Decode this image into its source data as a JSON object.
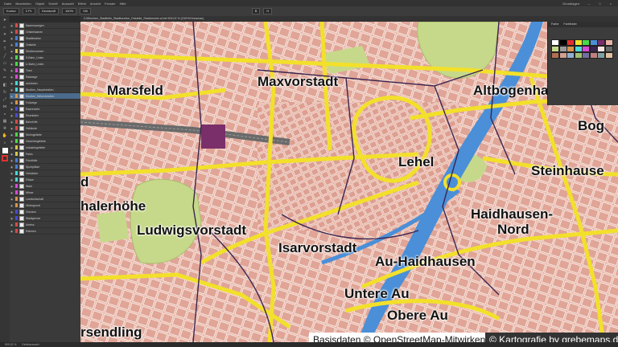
{
  "menubar": {
    "items": [
      "Datei",
      "Bearbeiten",
      "Objekt",
      "Schrift",
      "Auswahl",
      "Effekt",
      "Ansicht",
      "Fenster",
      "Hilfe"
    ],
    "workspace": "Grundlagen"
  },
  "controlbar": {
    "fields": [
      "Kontur",
      "2 Pt.",
      "Deckkraft",
      "100%",
      "Stil",
      "B",
      "H"
    ]
  },
  "document_tab": "2-München_Stadtteile_Stadtbezirke_Ortsteile_Straßennetz.ai bei 509,02 % (CMYK/Vorschau)",
  "layers": [
    {
      "name": "Namenszeigen",
      "color": "#d84a4a"
    },
    {
      "name": "Ortsteilnamen",
      "color": "#d84a4a"
    },
    {
      "name": "Stadtbezirke",
      "color": "#4a7fd8"
    },
    {
      "name": "Ortsteile",
      "color": "#4a7fd8"
    },
    {
      "name": "Straßennamen",
      "color": "#d8c84a"
    },
    {
      "name": "S-Bahn_Linien",
      "color": "#4ad84a"
    },
    {
      "name": "U-Bahn_Linien",
      "color": "#4ad84a"
    },
    {
      "name": "Tram",
      "color": "#d84ad8"
    },
    {
      "name": "Radwege",
      "color": "#d84ad8"
    },
    {
      "name": "Autobahn",
      "color": "#4ad8d8"
    },
    {
      "name": "Straßen_Hauptstraßen",
      "color": "#4ad8d8"
    },
    {
      "name": "Straßen_Nebenstraßen",
      "color": "#d8944a",
      "selected": true
    },
    {
      "name": "Fußwege",
      "color": "#d8944a"
    },
    {
      "name": "Radverkehr",
      "color": "#4a4ad8"
    },
    {
      "name": "Eisenbahn",
      "color": "#4a4ad8"
    },
    {
      "name": "Bahnhöfe",
      "color": "#d84a4a"
    },
    {
      "name": "Gebäude",
      "color": "#d84a4a"
    },
    {
      "name": "Wohngebiete",
      "color": "#4ad84a"
    },
    {
      "name": "Gewerbegebiete",
      "color": "#4ad84a"
    },
    {
      "name": "Industriegebiete",
      "color": "#d8c84a"
    },
    {
      "name": "Parks",
      "color": "#d8c84a"
    },
    {
      "name": "Friedhöfe",
      "color": "#4a7fd8"
    },
    {
      "name": "Sportplätze",
      "color": "#4a7fd8"
    },
    {
      "name": "Gewässer",
      "color": "#4ad8d8"
    },
    {
      "name": "Flüsse",
      "color": "#4ad8d8"
    },
    {
      "name": "Wald",
      "color": "#d84ad8"
    },
    {
      "name": "Wiese",
      "color": "#d84ad8"
    },
    {
      "name": "Landwirtschaft",
      "color": "#d8944a"
    },
    {
      "name": "Hintergrund",
      "color": "#d8944a"
    },
    {
      "name": "Grenzen",
      "color": "#4a4ad8"
    },
    {
      "name": "Stadtgrenze",
      "color": "#4a4ad8"
    },
    {
      "name": "Umriss",
      "color": "#d84a4a"
    },
    {
      "name": "Rahmen",
      "color": "#d84a4a"
    }
  ],
  "swatch_panel": {
    "tabs": [
      "Farbe",
      "Farbfelder"
    ]
  },
  "districts": [
    {
      "label": "Marsfeld"
    },
    {
      "label": "Maxvorstadt"
    },
    {
      "label": "Altbogenha"
    },
    {
      "label": "Bog"
    },
    {
      "label": "Lehel"
    },
    {
      "label": "Steinhause"
    },
    {
      "label": "halerhöhe"
    },
    {
      "label": "Ludwigsvorstadt"
    },
    {
      "label": "Isarvorstadt"
    },
    {
      "label": "Haidhausen-"
    },
    {
      "label": "Nord"
    },
    {
      "label": "Au-Haidhausen"
    },
    {
      "label": "Untere Au"
    },
    {
      "label": "Obere Au"
    },
    {
      "label": "rsendling"
    },
    {
      "label": "d"
    }
  ],
  "credits": {
    "basis": "Basisdaten © OpenStreetMap-Mitwirkende",
    "cartography": "© Kartografie by grebemaps.de"
  },
  "statusbar": {
    "zoom": "509,02 %",
    "tool": "Direktauswahl"
  },
  "colors": {
    "road_main": "#f2e02a",
    "road_edge": "#c9a300",
    "water": "#4a8fd8",
    "park": "#c8d88a",
    "block": "#e8b4a6"
  }
}
